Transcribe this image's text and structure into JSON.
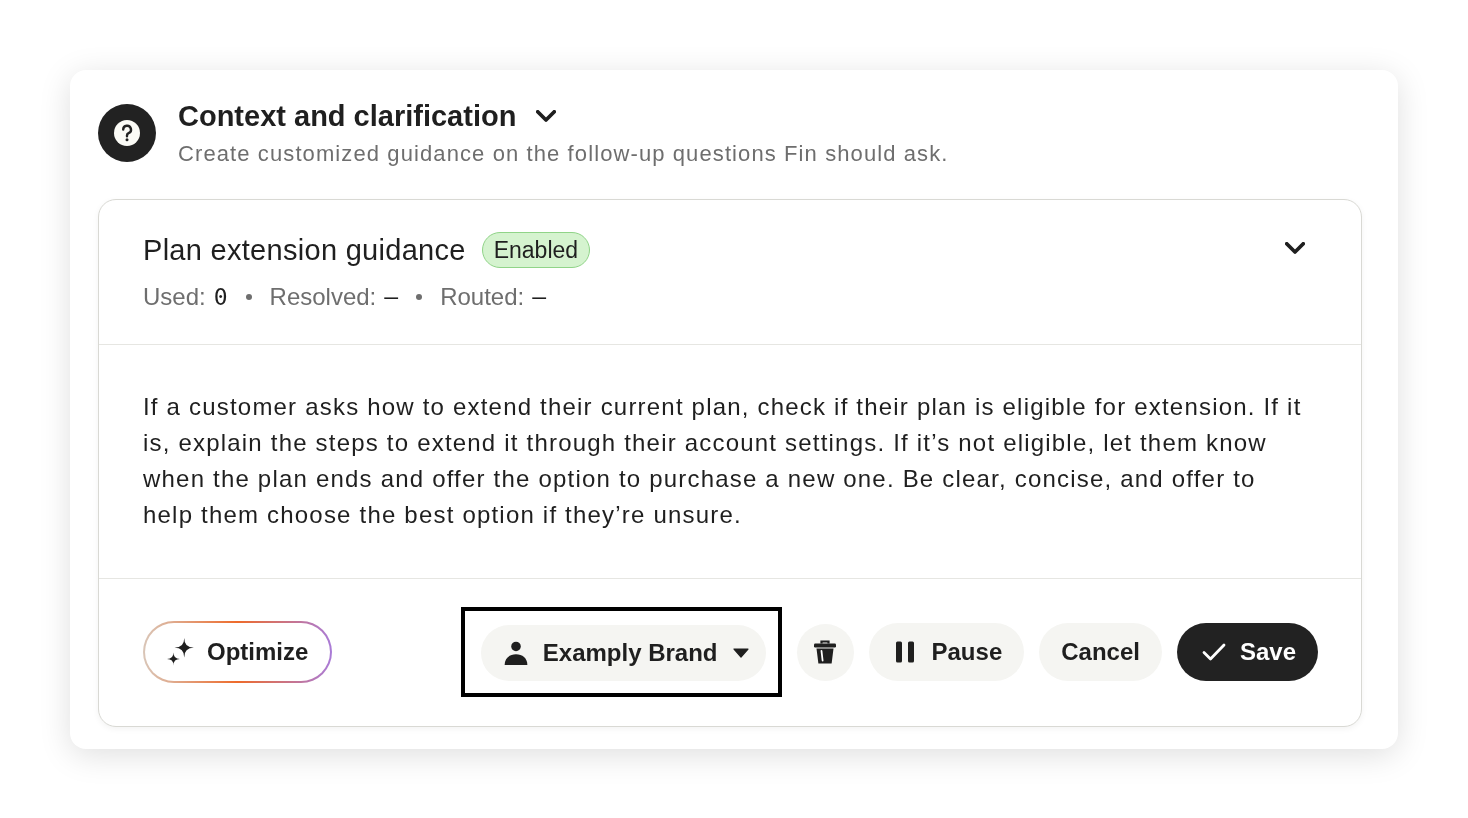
{
  "section": {
    "title": "Context and clarification",
    "expanded": true,
    "description": "Create customized guidance on the follow-up questions Fin should ask."
  },
  "guidance": {
    "title": "Plan extension guidance",
    "status": {
      "label": "Enabled",
      "kind": "enabled"
    },
    "expanded": true,
    "stats": [
      {
        "label": "Used:",
        "value": "0"
      },
      {
        "label": "Resolved:",
        "value": "–"
      },
      {
        "label": "Routed:",
        "value": "–"
      }
    ],
    "body": "If a customer asks how to extend their current plan, check if their plan is eligible for extension. If it is, explain the steps to extend it through their account settings. If it’s not eligible, let them know when the plan ends and offer the option to purchase a new one. Be clear, concise, and offer to help them choose the best option if they’re unsure."
  },
  "footer": {
    "actions": [
      {
        "kind": "optimize",
        "label": "Optimize"
      },
      {
        "kind": "brand",
        "label": "Examply Brand",
        "highlighted": true
      },
      {
        "kind": "delete"
      },
      {
        "kind": "pause",
        "label": "Pause"
      },
      {
        "kind": "cancel",
        "label": "Cancel"
      },
      {
        "kind": "save",
        "label": "Save"
      }
    ]
  }
}
